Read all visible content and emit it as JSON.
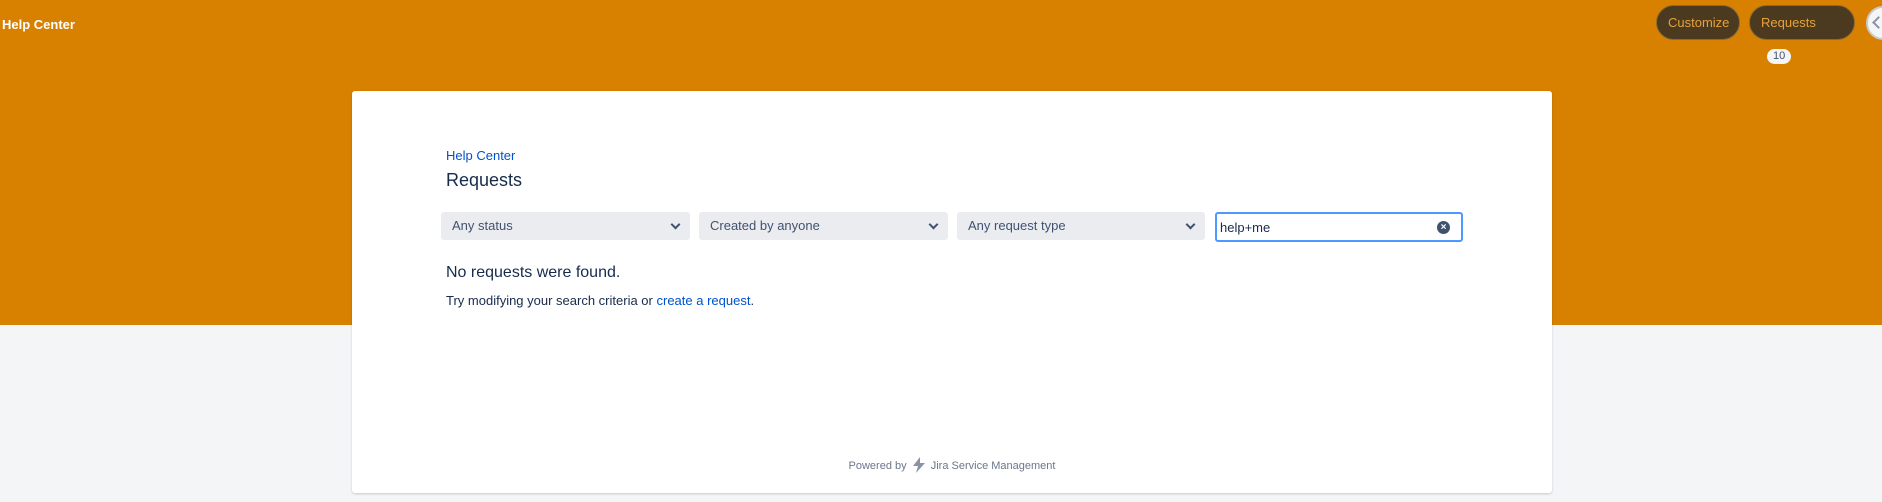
{
  "header": {
    "brand": "Help Center",
    "customize_label": "Customize",
    "requests_label": "Requests",
    "requests_count": "10"
  },
  "colors": {
    "banner": "#d88000",
    "link": "#0052cc",
    "focus": "#4c9aff"
  },
  "main": {
    "breadcrumb": "Help Center",
    "title": "Requests",
    "filters": {
      "status": "Any status",
      "created_by": "Created by anyone",
      "request_type": "Any request type"
    },
    "search": {
      "value": "help+me"
    },
    "empty_title": "No requests were found.",
    "empty_hint_prefix": "Try modifying your search criteria or ",
    "empty_hint_link": "create a request",
    "empty_hint_suffix": "."
  },
  "footer": {
    "powered_prefix": "Powered by",
    "powered_product": "Jira Service Management",
    "product_icon": "bolt-icon"
  }
}
